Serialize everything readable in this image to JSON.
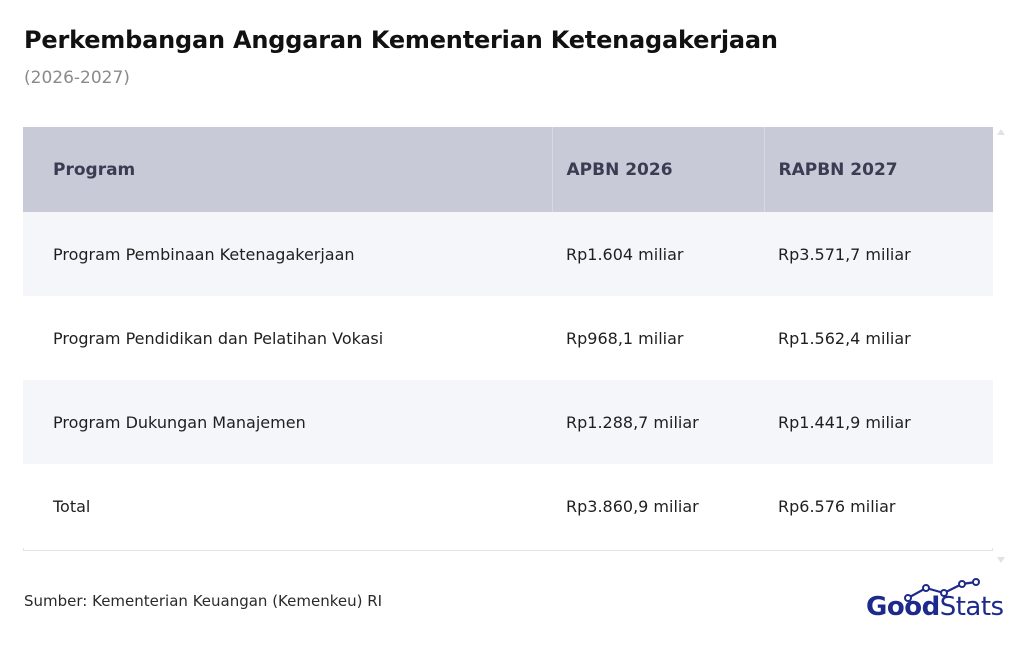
{
  "header": {
    "title": "Perkembangan Anggaran Kementerian Ketenagakerjaan",
    "subtitle": "(2026-2027)"
  },
  "chart_data": {
    "type": "table",
    "title": "Perkembangan Anggaran Kementerian Ketenagakerjaan",
    "subtitle": "(2026-2027)",
    "columns": [
      "Program",
      "APBN 2026",
      "RAPBN 2027"
    ],
    "rows": [
      [
        "Program Pembinaan Ketenagakerjaan",
        "Rp1.604 miliar",
        "Rp3.571,7 miliar"
      ],
      [
        "Program Pendidikan dan Pelatihan Vokasi",
        "Rp968,1 miliar",
        "Rp1.562,4 miliar"
      ],
      [
        "Program Dukungan Manajemen",
        "Rp1.288,7 miliar",
        "Rp1.441,9 miliar"
      ],
      [
        "Total",
        "Rp3.860,9 miliar",
        "Rp6.576 miliar"
      ]
    ]
  },
  "footer": {
    "source": "Sumber: Kementerian Keuangan (Kemenkeu) RI",
    "logo_good": "Good",
    "logo_stats": "Stats"
  },
  "colors": {
    "header_bg": "#c8cad8",
    "row_alt_bg": "#f5f6fa",
    "logo": "#1d2a8c"
  },
  "icons": {
    "scroll_up": "triangle-up-icon",
    "scroll_down": "triangle-down-icon",
    "logo_mark": "trend-line-icon"
  }
}
